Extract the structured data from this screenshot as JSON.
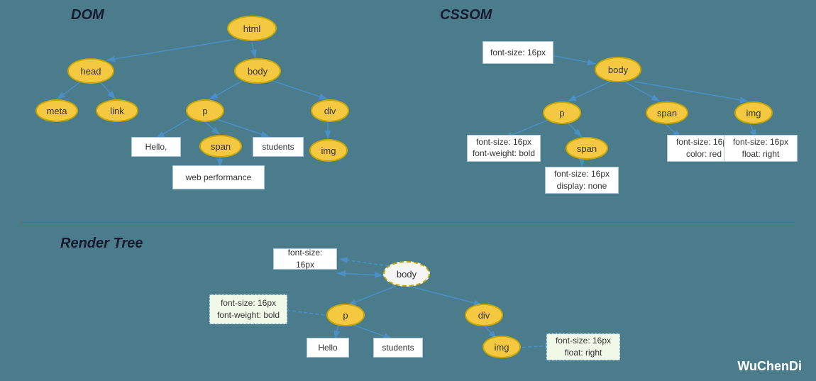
{
  "sections": {
    "dom_title": "DOM",
    "cssom_title": "CSSOM",
    "render_title": "Render Tree"
  },
  "dom_nodes": {
    "html": "html",
    "head": "head",
    "body": "body",
    "meta": "meta",
    "link": "link",
    "p": "p",
    "div": "div",
    "span": "span",
    "img": "img",
    "hello": "Hello,",
    "students": "students",
    "web_performance": "web performance"
  },
  "cssom_nodes": {
    "body": "body",
    "p": "p",
    "span": "span",
    "img": "img",
    "span_child": "span",
    "font_size_body": "font-size: 16px",
    "font_size_p": "font-size: 16px\nfont-weight: bold",
    "font_size_span": "font-size: 16px\ncolor: red",
    "font_size_img": "font-size: 16px\nfloat: right",
    "font_size_span_child": "font-size: 16px\ndisplay: none"
  },
  "render_nodes": {
    "body": "body",
    "p": "p",
    "div": "div",
    "img": "img",
    "hello": "Hello",
    "students": "students",
    "font_size_top": "font-size: 16px",
    "font_size_p": "font-size: 16px\nfont-weight: bold",
    "font_size_img": "font-size: 16px\nfloat: right"
  },
  "watermark": "WuChenDi"
}
